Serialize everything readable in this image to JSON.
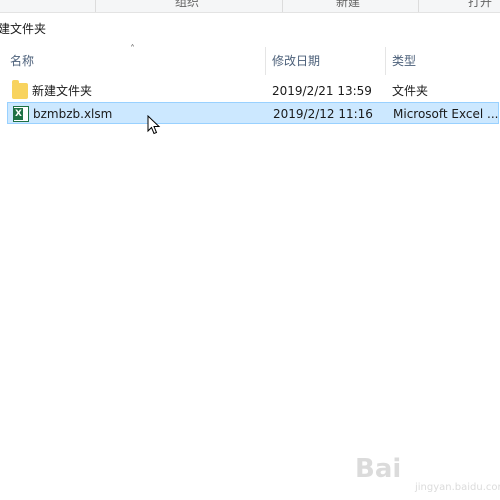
{
  "ribbon": {
    "groups": [
      "组织",
      "新建",
      "打开"
    ]
  },
  "address_bar": {
    "path": "建文件夹"
  },
  "columns": [
    {
      "label": "名称"
    },
    {
      "label": "修改日期"
    },
    {
      "label": "类型"
    }
  ],
  "files": [
    {
      "name": "新建文件夹",
      "modified": "2019/2/21 13:59",
      "type": "文件夹",
      "icon": "folder-icon",
      "selected": false
    },
    {
      "name": "bzmbzb.xlsm",
      "modified": "2019/2/12 11:16",
      "type": "Microsoft Excel ...",
      "icon": "excel-file-icon",
      "selected": true
    }
  ],
  "watermark": {
    "text": "Bai",
    "sub": "jingyan.baidu.com"
  },
  "colors": {
    "selection_bg": "#cce8ff",
    "selection_border": "#99d1ff",
    "header_text": "#4c607a",
    "excel_green": "#1e7145",
    "folder_yellow": "#f8d35e"
  }
}
